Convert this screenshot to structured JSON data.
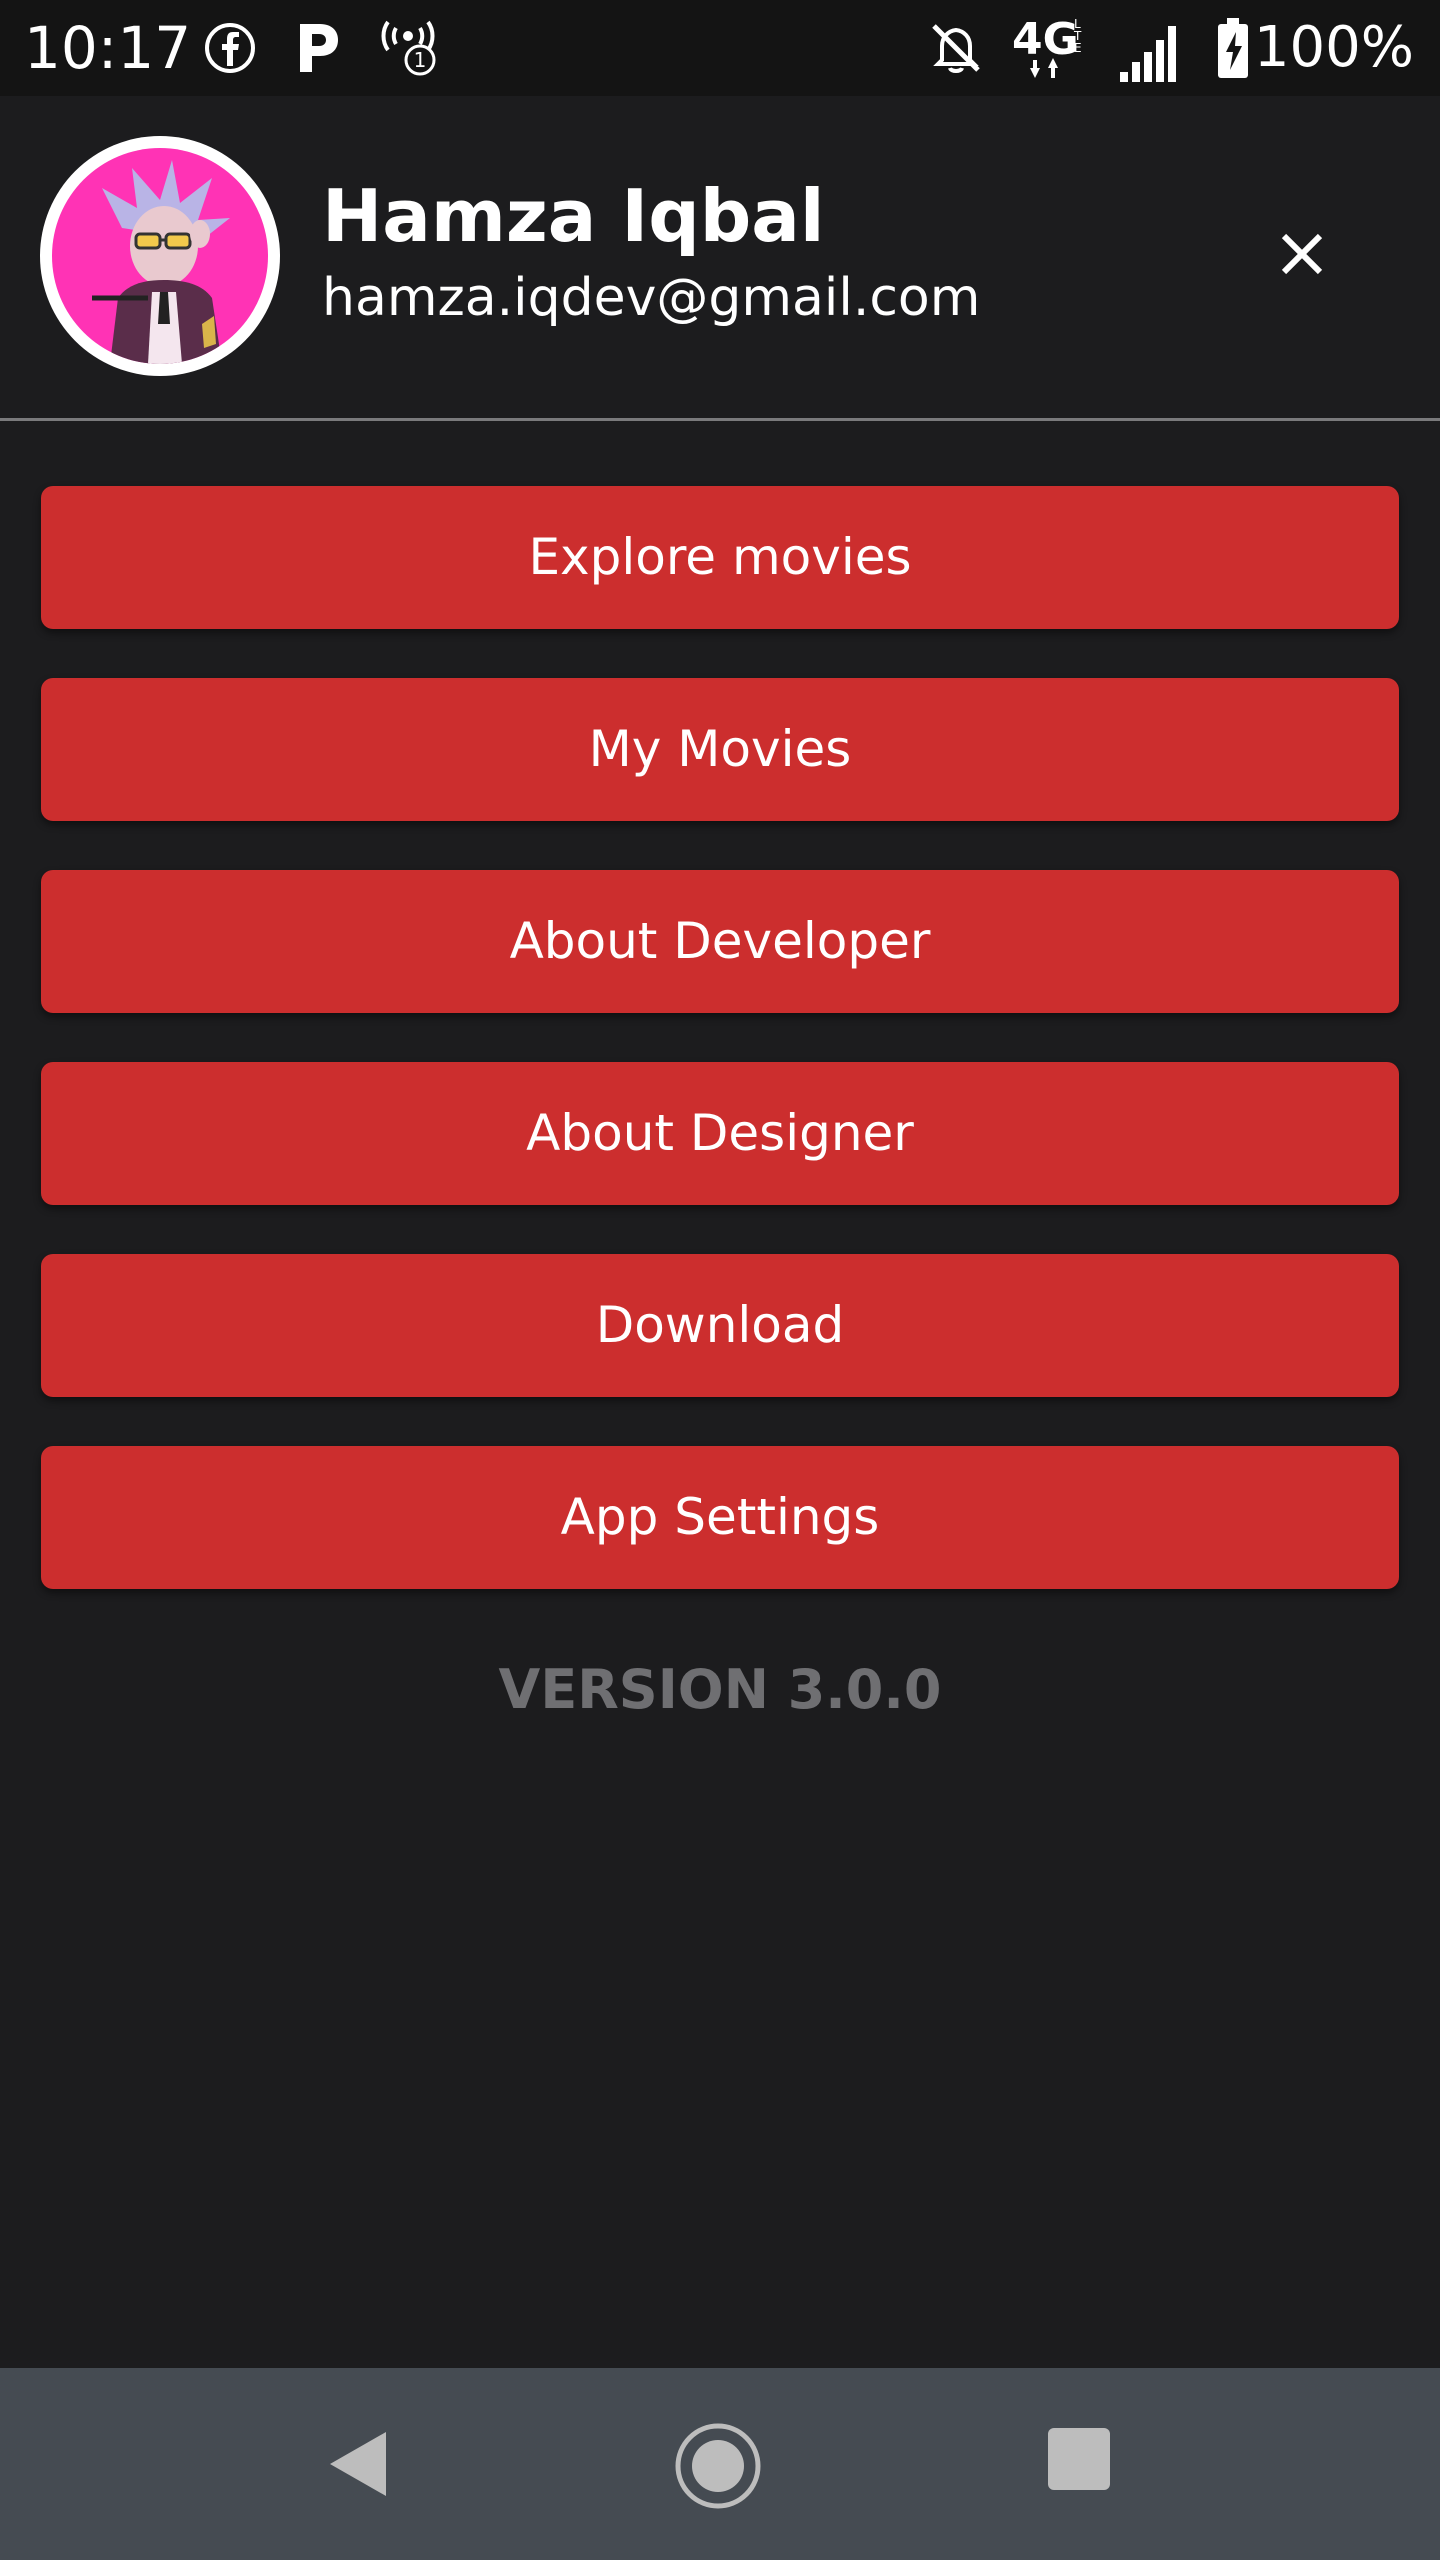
{
  "status_bar": {
    "time": "10:17",
    "battery_percent": "100%",
    "icons": [
      "facebook-icon",
      "parking-app-icon",
      "hotspot-icon",
      "notifications-off-icon",
      "lte-4g-icon",
      "cell-signal-icon",
      "battery-charging-icon"
    ]
  },
  "drawer_header": {
    "name": "Hamza Iqbal",
    "email": "hamza.iqdev@gmail.com"
  },
  "menu": {
    "items": [
      {
        "label": "Explore movies"
      },
      {
        "label": "My Movies"
      },
      {
        "label": "About Developer"
      },
      {
        "label": "About Designer"
      },
      {
        "label": "Download"
      },
      {
        "label": "App Settings"
      }
    ]
  },
  "footer": {
    "version": "VERSION 3.0.0"
  },
  "colors": {
    "background": "#1c1c1e",
    "button": "#cc2e2e",
    "version_text": "#6f6f72",
    "nav_bar": "#454b52"
  }
}
